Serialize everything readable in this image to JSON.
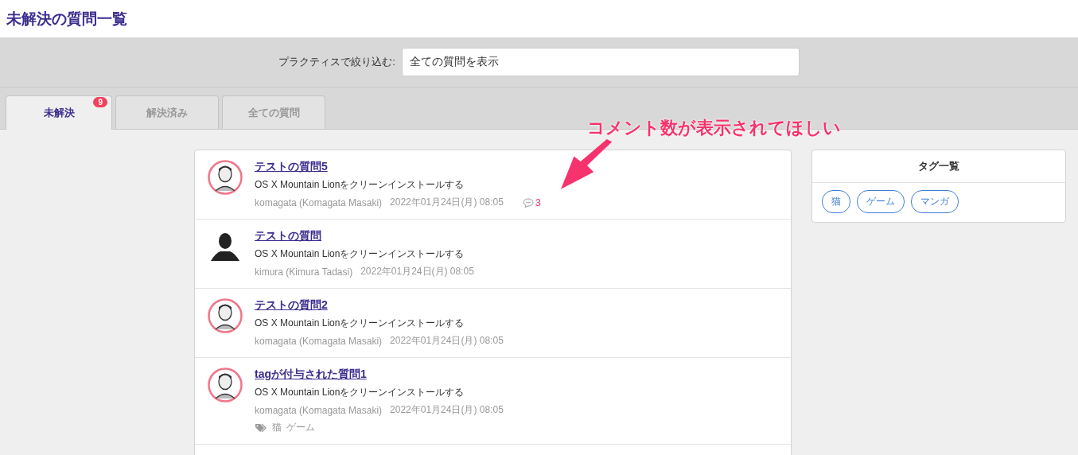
{
  "page_title": "未解決の質問一覧",
  "filter": {
    "label": "プラクティスで絞り込む:",
    "value": "全ての質問を表示"
  },
  "tabs": [
    {
      "label": "未解決",
      "selected": true,
      "badge": "9"
    },
    {
      "label": "解決済み",
      "selected": false
    },
    {
      "label": "全ての質問",
      "selected": false
    }
  ],
  "questions": [
    {
      "title": "テストの質問5",
      "practice": "OS X Mountain Lionをクリーンインストールする",
      "author": "komagata (Komagata Masaki)",
      "date": "2022年01月24日(月) 08:05",
      "avatar": {
        "kind": "illustrated"
      },
      "comments": "3"
    },
    {
      "title": "テストの質問",
      "practice": "OS X Mountain Lionをクリーンインストールする",
      "author": "kimura (Kimura Tadasi)",
      "date": "2022年01月24日(月) 08:05",
      "avatar": {
        "kind": "silhouette"
      }
    },
    {
      "title": "テストの質問2",
      "practice": "OS X Mountain Lionをクリーンインストールする",
      "author": "komagata (Komagata Masaki)",
      "date": "2022年01月24日(月) 08:05",
      "avatar": {
        "kind": "illustrated"
      }
    },
    {
      "title": "tagが付与された質問1",
      "practice": "OS X Mountain Lionをクリーンインストールする",
      "author": "komagata (Komagata Masaki)",
      "date": "2022年01月24日(月) 08:05",
      "avatar": {
        "kind": "illustrated"
      },
      "tags": [
        "猫",
        "ゲーム"
      ]
    }
  ],
  "tag_list": {
    "title": "タグ一覧",
    "tags": [
      "猫",
      "ゲーム",
      "マンガ"
    ]
  },
  "annotation": {
    "text": "コメント数が表示されてほしい"
  }
}
